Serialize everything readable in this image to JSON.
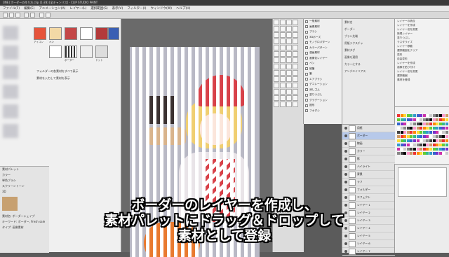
{
  "titlebar": {
    "title": "[INE] ポーダーの作り方.clip (1-28) [全キャンバス] - CLIP STUDIO PAINT"
  },
  "menubar": [
    "ファイル(F)",
    "編集(E)",
    "アニメーション(A)",
    "レイヤー(L)",
    "選択範囲(S)",
    "表示(V)",
    "フィルター(I)",
    "ウィンドウ(W)",
    "ヘルプ(H)"
  ],
  "assets": {
    "thumb_labels": [
      "アイコン",
      "ペン",
      "ボーダー",
      "ドット"
    ],
    "note1": "フォルダーの各素材をすべて表示",
    "note2": "素材を入力して素材を表示"
  },
  "left_bottom": {
    "tree": [
      "素材パレット",
      "カラー",
      "単色ブラシ",
      "スクリーントーン",
      "3D"
    ],
    "info": [
      "素材名: ボーダーシェイプ",
      "キーワード: ボーダー, Fresh sale",
      "タイプ: 画像素材"
    ]
  },
  "subtools": [
    "一般素材",
    "画像素材",
    "ブラシ",
    "3Dポーズ",
    "モノクロパターン",
    "カラーパターン",
    "漫画素材",
    "画像化レイヤー",
    "ペン",
    "鉛筆",
    "筆",
    "エアブラシ",
    "デコレーション",
    "消しゴム",
    "塗りつぶし",
    "グラデーション",
    "図形",
    "フキダシ"
  ],
  "properties": [
    "素材名",
    "ボーダー",
    "ブラシ先端",
    "用紙テクスチャ",
    "素材タグ",
    "画像を適用",
    "カラーにする",
    "アンチエイリアス"
  ],
  "history": [
    "レイヤーの統合",
    "レイヤーを作成",
    "レイヤー名を変更",
    "新規レイヤー",
    "塗りつぶし",
    "ラスタライズ",
    "レイヤー移動",
    "選択範囲をクリア",
    "変形",
    "自由変形",
    "レイヤーを作成",
    "画像を貼り付け",
    "レイヤー名を変更",
    "選択範囲",
    "素材を登録"
  ],
  "layers": [
    "用紙",
    "ボーダー",
    "線画",
    "カラー",
    "影",
    "ハイライト",
    "背景",
    "ラフ",
    "フォルダー",
    "エフェクト",
    "レイヤー 1",
    "レイヤー 2",
    "レイヤー 3",
    "レイヤー 4",
    "レイヤー 5",
    "レイヤー 6",
    "レイヤー 7"
  ],
  "colors": {
    "accent": "#2f5db1",
    "selected_layer": "#b7c9ea"
  },
  "caption": {
    "line1": "ボーダーのレイヤーを作成し、",
    "line2": "素材パレットにドラッグ＆ドロップして",
    "line3": "素材として登録"
  }
}
